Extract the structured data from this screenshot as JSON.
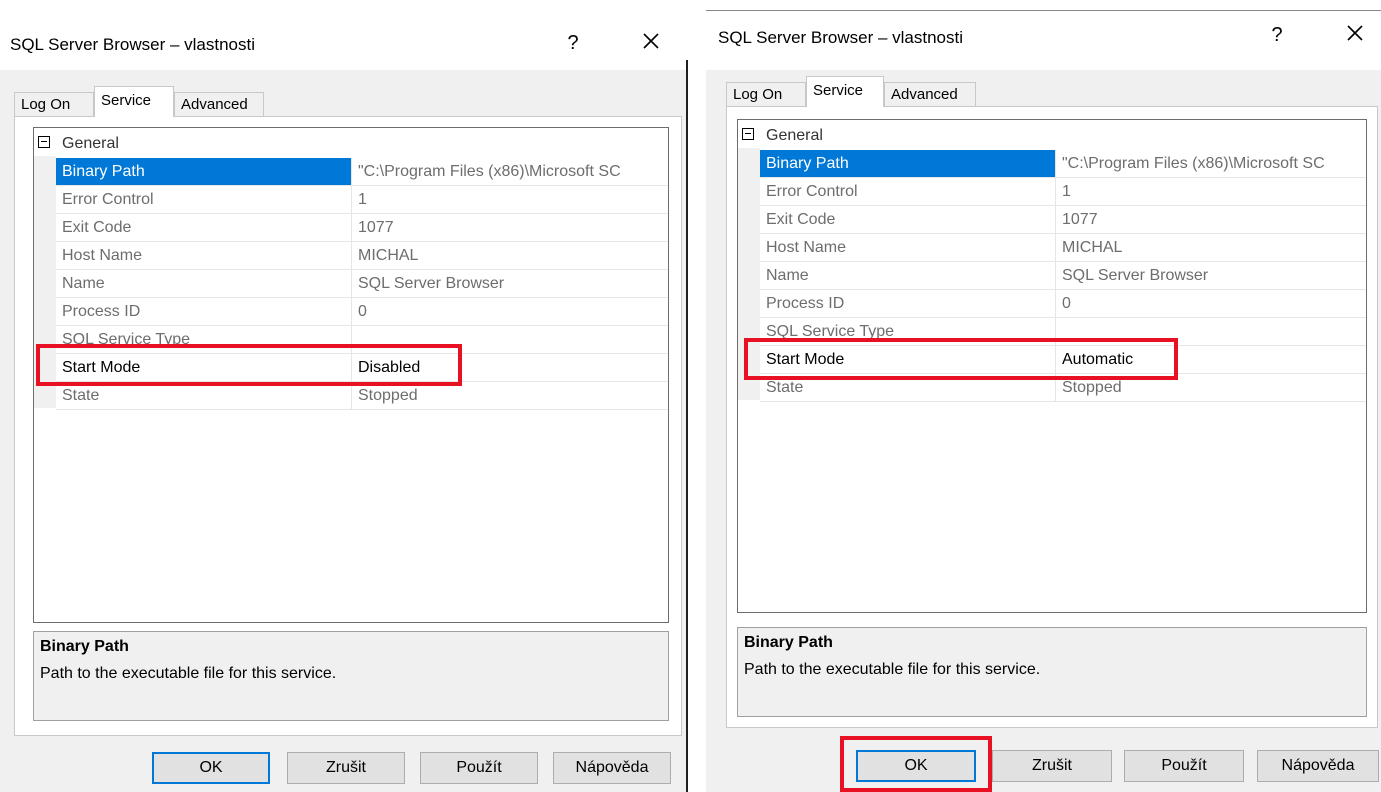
{
  "left_dialog": {
    "title": "SQL Server Browser – vlastnosti",
    "help": "?",
    "tabs": [
      "Log On",
      "Service",
      "Advanced"
    ],
    "category": "General",
    "properties": [
      {
        "name": "Binary Path",
        "value": "\"C:\\Program Files (x86)\\Microsoft SC"
      },
      {
        "name": "Error Control",
        "value": "1"
      },
      {
        "name": "Exit Code",
        "value": "1077"
      },
      {
        "name": "Host Name",
        "value": "MICHAL"
      },
      {
        "name": "Name",
        "value": "SQL Server Browser"
      },
      {
        "name": "Process ID",
        "value": "0"
      },
      {
        "name": "SQL Service Type",
        "value": ""
      },
      {
        "name": "Start Mode",
        "value": "Disabled"
      },
      {
        "name": "State",
        "value": "Stopped"
      }
    ],
    "description": {
      "title": "Binary Path",
      "text": "Path to the executable file for this service."
    },
    "buttons": {
      "ok": "OK",
      "cancel": "Zrušit",
      "apply": "Použít",
      "help": "Nápověda"
    }
  },
  "right_dialog": {
    "title": "SQL Server Browser – vlastnosti",
    "help": "?",
    "tabs": [
      "Log On",
      "Service",
      "Advanced"
    ],
    "category": "General",
    "properties": [
      {
        "name": "Binary Path",
        "value": "\"C:\\Program Files (x86)\\Microsoft SC"
      },
      {
        "name": "Error Control",
        "value": "1"
      },
      {
        "name": "Exit Code",
        "value": "1077"
      },
      {
        "name": "Host Name",
        "value": "MICHAL"
      },
      {
        "name": "Name",
        "value": "SQL Server Browser"
      },
      {
        "name": "Process ID",
        "value": "0"
      },
      {
        "name": "SQL Service Type",
        "value": ""
      },
      {
        "name": "Start Mode",
        "value": "Automatic"
      },
      {
        "name": "State",
        "value": "Stopped"
      }
    ],
    "description": {
      "title": "Binary Path",
      "text": "Path to the executable file for this service."
    },
    "buttons": {
      "ok": "OK",
      "cancel": "Zrušit",
      "apply": "Použít",
      "help": "Nápověda"
    }
  },
  "colors": {
    "selection": "#0078d7",
    "highlight": "#e81123",
    "dialog_bg": "#f0f0f0"
  },
  "icons": [
    "close-icon",
    "collapse-icon"
  ]
}
